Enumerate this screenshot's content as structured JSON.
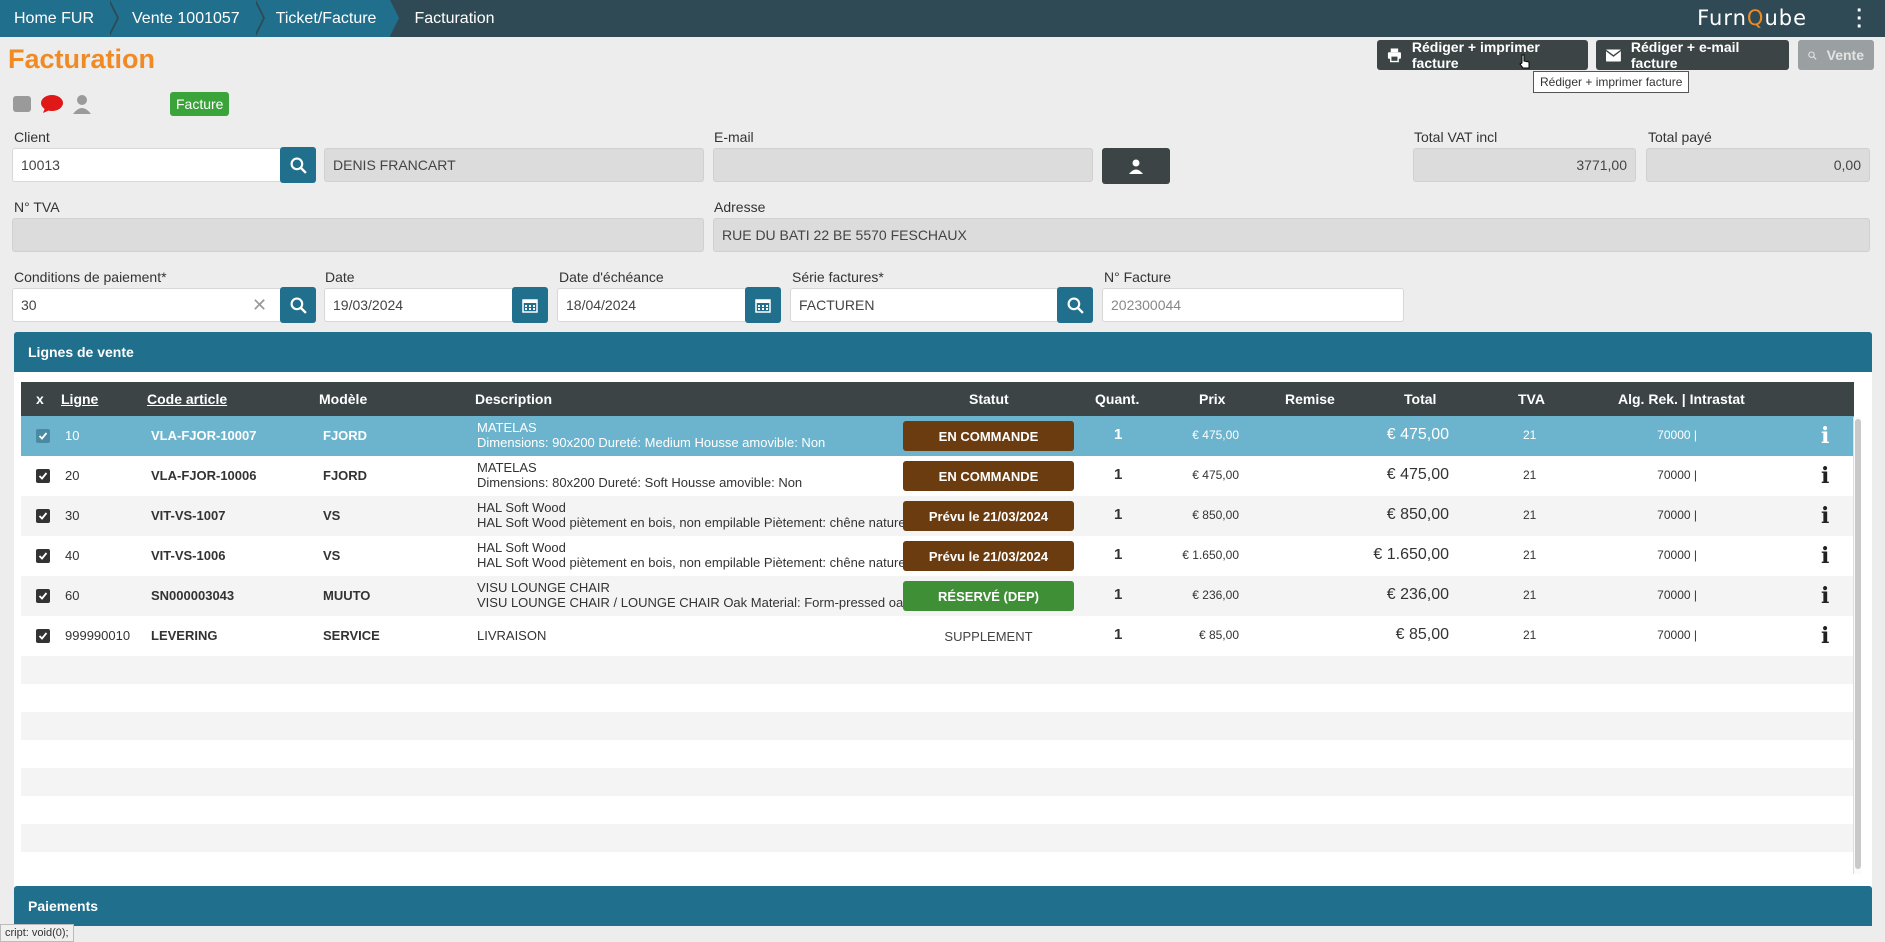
{
  "breadcrumb": [
    "Home FUR",
    "Vente 1001057",
    "Ticket/Facture",
    "Facturation"
  ],
  "brand": {
    "pre": "Furn",
    "q": "Q",
    "post": "ube"
  },
  "page_title": "Facturation",
  "toolbar": {
    "print_label": "Rédiger + imprimer facture",
    "email_label": "Rédiger + e-mail facture",
    "vente_label": "Vente",
    "tooltip": "Rédiger + imprimer facture"
  },
  "badge": "Facture",
  "form": {
    "client_label": "Client",
    "client_value": "10013",
    "client_name": "DENIS FRANCART",
    "email_label": "E-mail",
    "email_value": "",
    "total_vat_label": "Total VAT incl",
    "total_vat_value": "3771,00",
    "total_paid_label": "Total payé",
    "total_paid_value": "0,00",
    "tva_label": "N° TVA",
    "tva_value": "",
    "address_label": "Adresse",
    "address_value": "RUE DU BATI 22 BE 5570 FESCHAUX",
    "conditions_label": "Conditions de paiement*",
    "conditions_value": "30",
    "date_label": "Date",
    "date_value": "19/03/2024",
    "due_label": "Date d'échéance",
    "due_value": "18/04/2024",
    "series_label": "Série factures*",
    "series_value": "FACTUREN",
    "invoice_no_label": "N° Facture",
    "invoice_no_value": "202300044"
  },
  "sales_panel_title": "Lignes de vente",
  "payments_panel_title": "Paiements",
  "grid": {
    "headers": {
      "x": "x",
      "line": "Ligne",
      "code": "Code article",
      "model": "Modèle",
      "desc": "Description",
      "status": "Statut",
      "qty": "Quant.",
      "price": "Prix",
      "discount": "Remise",
      "total": "Total",
      "vat": "TVA",
      "alg": "Alg. Rek. | Intrastat"
    },
    "rows": [
      {
        "line": "10",
        "code": "VLA-FJOR-10007",
        "model": "FJORD",
        "d1": "MATELAS",
        "d2": "Dimensions: 90x200 Dureté: Medium Housse amovible: Non",
        "status": "EN COMMANDE",
        "status_kind": "brown",
        "qty": "1",
        "price": "€ 475,00",
        "total": "€ 475,00",
        "vat": "21",
        "alg": "70000 |",
        "info": "i"
      },
      {
        "line": "20",
        "code": "VLA-FJOR-10006",
        "model": "FJORD",
        "d1": "MATELAS",
        "d2": "Dimensions: 80x200 Dureté: Soft Housse amovible: Non",
        "status": "EN COMMANDE",
        "status_kind": "brown",
        "qty": "1",
        "price": "€ 475,00",
        "total": "€ 475,00",
        "vat": "21",
        "alg": "70000 |",
        "info": "i"
      },
      {
        "line": "30",
        "code": "VIT-VS-1007",
        "model": "VS",
        "d1": "HAL Soft Wood",
        "d2": "HAL Soft Wood piètement en bois, non empilable Piètement: chêne naturel Couleur: Stone Grey",
        "status": "Prévu le 21/03/2024",
        "status_kind": "brown",
        "qty": "1",
        "price": "€ 850,00",
        "total": "€ 850,00",
        "vat": "21",
        "alg": "70000 |",
        "info": "i"
      },
      {
        "line": "40",
        "code": "VIT-VS-1006",
        "model": "VS",
        "d1": "HAL Soft Wood",
        "d2": "HAL Soft Wood piètement en bois, non empilable Piètement: chêne naturel Couleur: Stone Grey",
        "status": "Prévu le 21/03/2024",
        "status_kind": "brown",
        "qty": "1",
        "price": "€ 1.650,00",
        "total": "€ 1.650,00",
        "vat": "21",
        "alg": "70000 |",
        "info": "i"
      },
      {
        "line": "60",
        "code": "SN000003043",
        "model": "MUUTO",
        "d1": "VISU LOUNGE CHAIR",
        "d2": "VISU LOUNGE CHAIR / LOUNGE CHAIR Oak Material: Form-pressed oak veneer",
        "status": "RÉSERVÉ (DEP)",
        "status_kind": "green",
        "qty": "1",
        "price": "€ 236,00",
        "total": "€ 236,00",
        "vat": "21",
        "alg": "70000 |",
        "info": "i"
      },
      {
        "line": "999990010",
        "code": "LEVERING",
        "model": "SERVICE",
        "d1": "LIVRAISON",
        "d2": "",
        "status": "SUPPLEMENT",
        "status_kind": "text",
        "qty": "1",
        "price": "€ 85,00",
        "total": "€ 85,00",
        "vat": "21",
        "alg": "70000 |",
        "info": "i"
      }
    ]
  },
  "statusbar": "cript: void(0);",
  "colors": {
    "accent": "#f08a24",
    "primary": "#1f6f8d",
    "dark": "#3c4446",
    "topbar": "#2f4a55",
    "brown": "#6b3c10",
    "green": "#3f8f36"
  }
}
